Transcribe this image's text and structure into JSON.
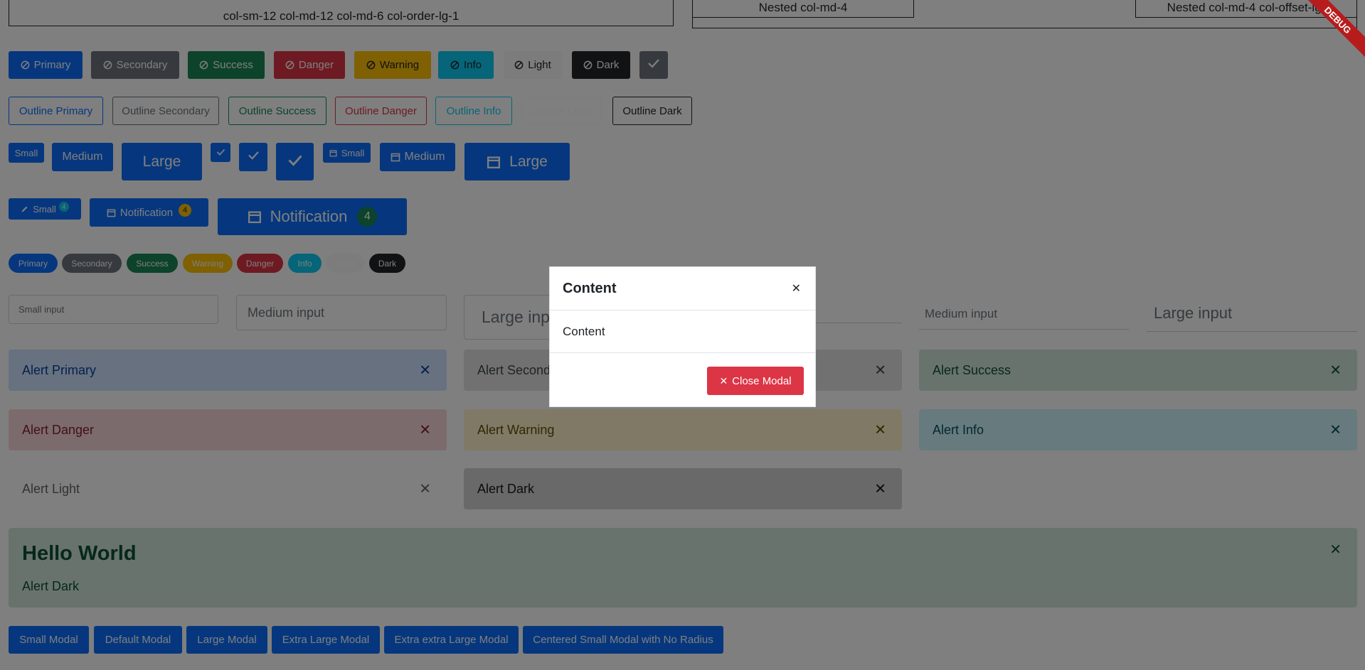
{
  "grid": {
    "box1": "col-sm-12 col-md-12 col-md-6 col-order-lg-1",
    "box2": "Nested col-md-4",
    "box3": "Nested col-md-4 col-offset-lg-"
  },
  "debug_banner": "DEBUG",
  "solid_buttons": [
    "Primary",
    "Secondary",
    "Success",
    "Danger",
    "Warning",
    "Info",
    "Light",
    "Dark"
  ],
  "outline_buttons": [
    "Outline Primary",
    "Outline Secondary",
    "Outline Success",
    "Outline Danger",
    "Outline Info",
    "Outline Light",
    "Outline Dark"
  ],
  "size_buttons": {
    "small": "Small",
    "medium": "Medium",
    "large": "Large"
  },
  "notification_buttons": {
    "small": "Small",
    "medium": "Notification",
    "large": "Notification",
    "count": "4"
  },
  "pills": [
    "Primary",
    "Secondary",
    "Success",
    "Warning",
    "Danger",
    "Info",
    "Light",
    "Dark"
  ],
  "inputs": {
    "small": "Small input",
    "medium": "Medium input",
    "large": "Large input",
    "medium_ul": "Medium input",
    "large_ul": "Large input"
  },
  "alerts": {
    "primary": "Alert Primary",
    "secondary": "Alert Secondary",
    "success": "Alert Success",
    "danger": "Alert Danger",
    "warning": "Alert Warning",
    "info": "Alert Info",
    "light": "Alert Light",
    "dark": "Alert Dark"
  },
  "big_alert": {
    "title": "Hello World",
    "body": "Alert Dark"
  },
  "modal_buttons": [
    "Small Modal",
    "Default Modal",
    "Large Modal",
    "Extra Large Modal",
    "Extra extra Large Modal",
    "Centered Small Modal with No Radius"
  ],
  "modal": {
    "title": "Content",
    "body": "Content",
    "close_label": "Close Modal"
  },
  "colors": {
    "primary": "#0d6efd",
    "secondary": "#6c757d",
    "success": "#198754",
    "danger": "#dc3545",
    "warning": "#ffc107",
    "info": "#0dcaf0",
    "light": "#f8f9fa",
    "dark": "#212529"
  }
}
